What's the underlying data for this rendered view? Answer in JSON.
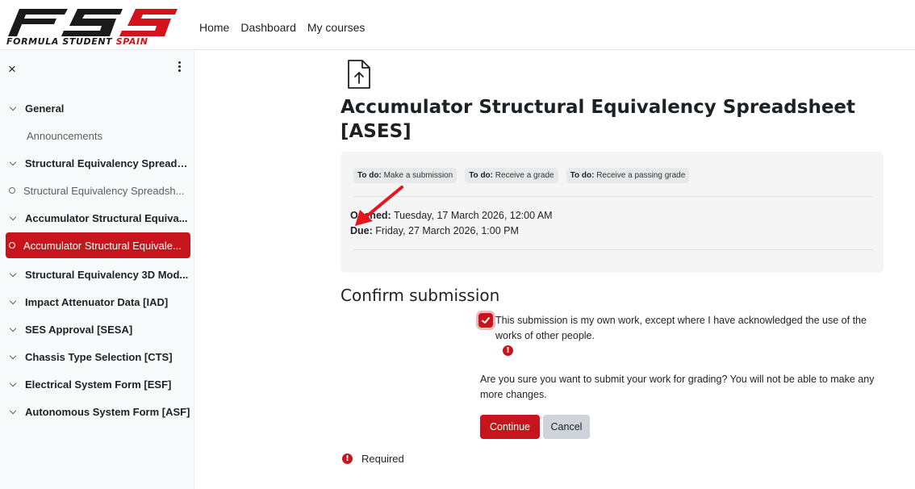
{
  "logo": {
    "tagline_main": "FORMULA STUDENT",
    "tagline_accent": "SPAIN"
  },
  "nav": {
    "home": "Home",
    "dashboard": "Dashboard",
    "my_courses": "My courses"
  },
  "sidebar": {
    "items": [
      {
        "type": "section",
        "label": "General"
      },
      {
        "type": "sub",
        "label": "Announcements"
      },
      {
        "type": "section",
        "label": "Structural Equivalency Spreads..."
      },
      {
        "type": "activity",
        "label": "Structural Equivalency Spreadsh..."
      },
      {
        "type": "section",
        "label": "Accumulator Structural Equiva..."
      },
      {
        "type": "activity-active",
        "label": "Accumulator Structural Equivale..."
      },
      {
        "type": "section",
        "label": "Structural Equivalency 3D Mod..."
      },
      {
        "type": "section",
        "label": "Impact Attenuator Data [IAD]"
      },
      {
        "type": "section",
        "label": "SES Approval [SESA]"
      },
      {
        "type": "section",
        "label": "Chassis Type Selection [CTS]"
      },
      {
        "type": "section",
        "label": "Electrical System Form [ESF]"
      },
      {
        "type": "section",
        "label": "Autonomous System Form [ASF]"
      }
    ]
  },
  "main": {
    "title": "Accumulator Structural Equivalency Spreadsheet [ASES]",
    "badges": [
      {
        "prefix": "To do:",
        "text": "Make a submission"
      },
      {
        "prefix": "To do:",
        "text": "Receive a grade"
      },
      {
        "prefix": "To do:",
        "text": "Receive a passing grade"
      }
    ],
    "opened_label": "Opened:",
    "opened_value": "Tuesday, 17 March 2026, 12:00 AM",
    "due_label": "Due:",
    "due_value": "Friday, 27 March 2026, 1:00 PM",
    "confirm_title": "Confirm submission",
    "statement": "This submission is my own work, except where I have acknowledged the use of the works of other people.",
    "question": "Are you sure you want to submit your work for grading? You will not be able to make any more changes.",
    "continue_label": "Continue",
    "cancel_label": "Cancel",
    "required_label": "Required"
  },
  "colors": {
    "accent": "#c8141c",
    "sidebar_bg": "#f8f9fa"
  }
}
